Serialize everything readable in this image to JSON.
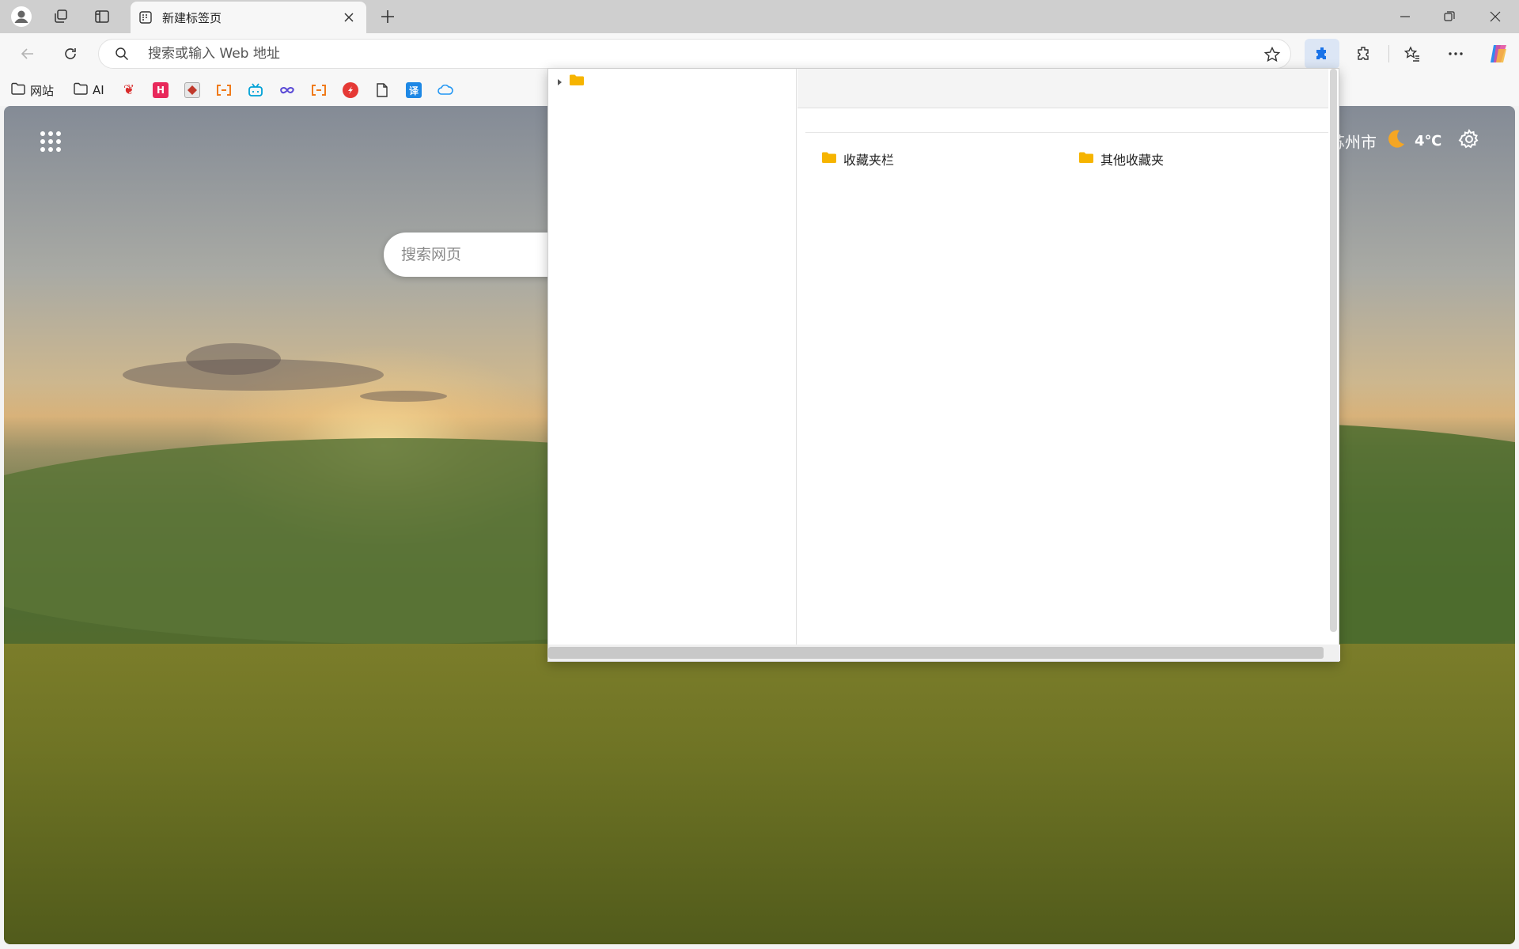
{
  "tab": {
    "title": "新建标签页"
  },
  "address": {
    "placeholder": "搜索或输入 Web 地址"
  },
  "bookmarks_bar": [
    {
      "label": "网站",
      "icon": "folder-icon"
    },
    {
      "label": "AI",
      "icon": "folder-icon"
    }
  ],
  "bookmark_icons": [
    "bookmark-app-1",
    "bookmark-h",
    "bookmark-red",
    "bookmark-orange-1",
    "bookmark-bilibili",
    "bookmark-infinity",
    "bookmark-orange-2",
    "bookmark-red-circle",
    "bookmark-doc",
    "bookmark-translate",
    "bookmark-cloud"
  ],
  "bookmark_glyphs": {
    "h": "H",
    "translate": "译"
  },
  "page": {
    "search_placeholder": "搜索网页",
    "weather": {
      "city": "苏州市",
      "temp": "4℃"
    }
  },
  "popup": {
    "folders": [
      {
        "label": "收藏夹栏"
      },
      {
        "label": "其他收藏夹"
      }
    ]
  },
  "colors": {
    "accent": "#1a73e8",
    "folder": "#f6b400"
  }
}
